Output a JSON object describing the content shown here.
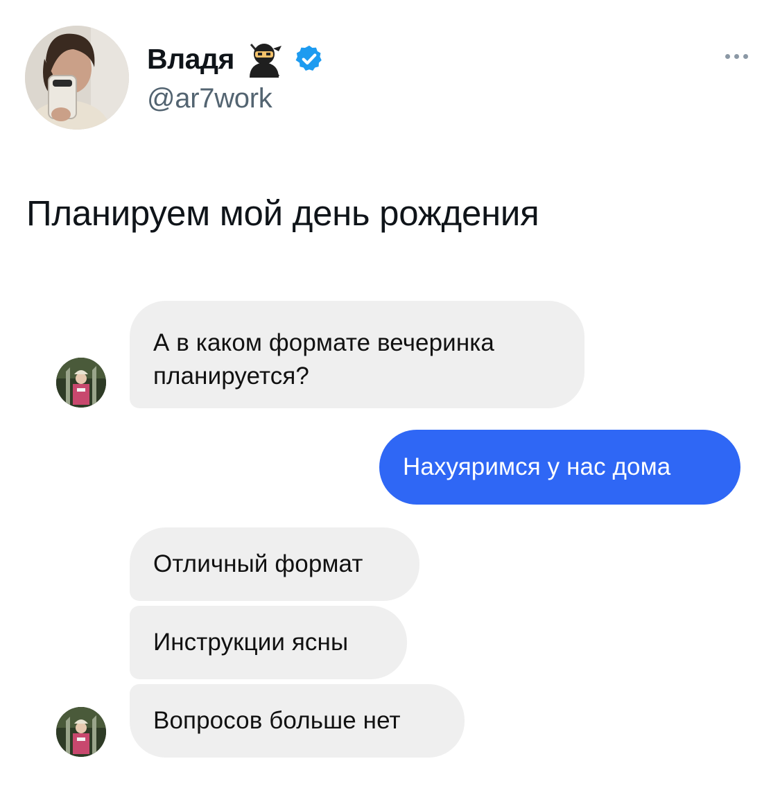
{
  "author": {
    "display_name": "Владя",
    "handle": "@ar7work",
    "name_emoji_icon": "ninja-icon",
    "verified_icon": "verified-badge-icon",
    "avatar_icon": "profile-photo"
  },
  "tweet": {
    "text": "Планируем мой день рождения"
  },
  "chat": {
    "messages": [
      {
        "side": "incoming",
        "text": "А в каком формате вечеринка планируется?"
      },
      {
        "side": "outgoing",
        "text": "Нахуяримся у нас дома"
      },
      {
        "side": "incoming",
        "text": "Отличный формат"
      },
      {
        "side": "incoming",
        "text": "Инструкции ясны"
      },
      {
        "side": "incoming",
        "text": "Вопросов больше нет"
      }
    ],
    "incoming_color": "#efefef",
    "outgoing_color": "#2f67f5"
  },
  "colors": {
    "verified": "#1d9bf0",
    "handle": "#536471"
  }
}
